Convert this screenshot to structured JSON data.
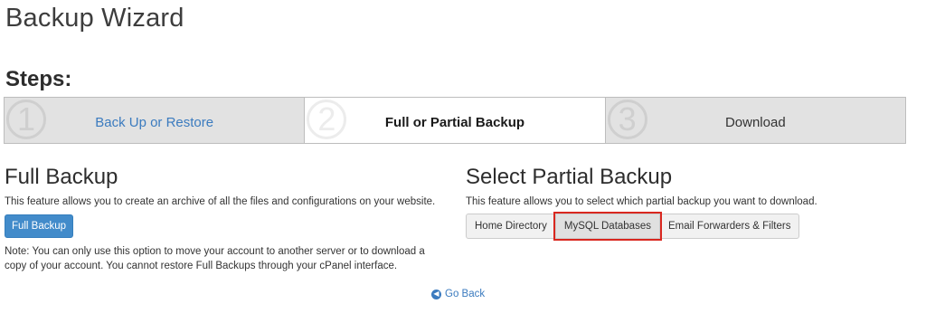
{
  "page": {
    "title": "Backup Wizard"
  },
  "steps": {
    "heading": "Steps:",
    "items": [
      {
        "number": "1",
        "label": "Back Up or Restore"
      },
      {
        "number": "2",
        "label": "Full or Partial Backup"
      },
      {
        "number": "3",
        "label": "Download"
      }
    ]
  },
  "full_backup": {
    "title": "Full Backup",
    "description": "This feature allows you to create an archive of all the files and configurations on your website.",
    "button_label": "Full Backup",
    "note": "Note: You can only use this option to move your account to another server or to download a copy of your account. You cannot restore Full Backups through your cPanel interface."
  },
  "partial_backup": {
    "title": "Select Partial Backup",
    "description": "This feature allows you to select which partial backup you want to download.",
    "buttons": [
      "Home Directory",
      "MySQL Databases",
      "Email Forwarders & Filters"
    ]
  },
  "footer": {
    "go_back": "Go Back"
  },
  "colors": {
    "link": "#3b7bbf",
    "primary": "#428bca",
    "highlight": "#d9271f"
  },
  "icons": {
    "go_back": "arrow-left-circle-icon"
  }
}
